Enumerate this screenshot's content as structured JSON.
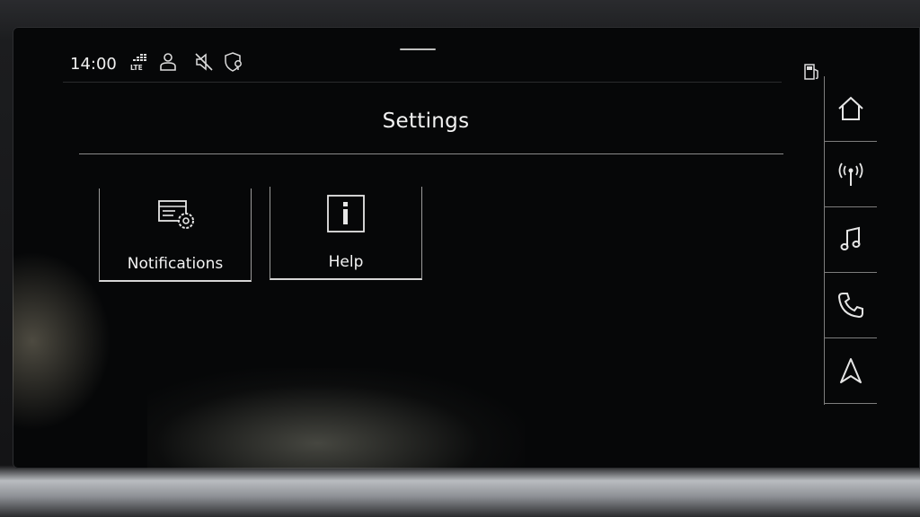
{
  "status_bar": {
    "time": "14:00",
    "icons": [
      "signal-lte-icon",
      "user-profile-icon",
      "mute-icon",
      "location-privacy-icon"
    ],
    "right_icon": "fuel-pump-icon"
  },
  "page": {
    "title": "Settings"
  },
  "tiles": [
    {
      "label": "Notifications",
      "icon": "notifications-settings-icon"
    },
    {
      "label": "Help",
      "icon": "info-icon"
    }
  ],
  "nav_rail": [
    {
      "name": "home",
      "icon": "home-icon"
    },
    {
      "name": "radio",
      "icon": "radio-antenna-icon"
    },
    {
      "name": "media",
      "icon": "music-note-icon"
    },
    {
      "name": "phone",
      "icon": "phone-icon"
    },
    {
      "name": "navigation",
      "icon": "navigation-arrow-icon"
    }
  ],
  "colors": {
    "background": "#060708",
    "text": "#f0f0f0",
    "divider": "#8a8a8a"
  }
}
